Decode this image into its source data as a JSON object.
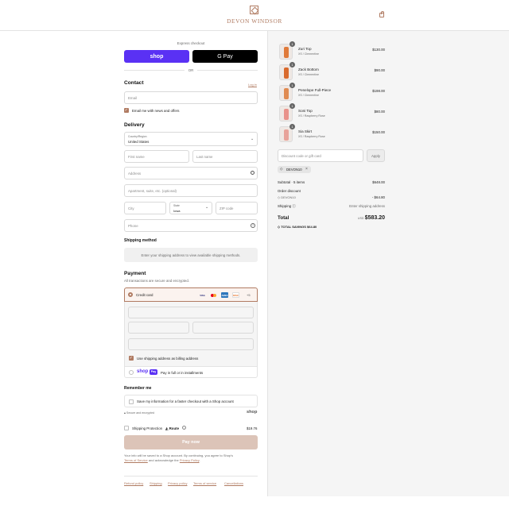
{
  "header": {
    "brand": "DEVON WINDSOR"
  },
  "express": {
    "label": "Express checkout",
    "shop_pay": "shop",
    "gpay": "G Pay",
    "or": "OR"
  },
  "contact": {
    "title": "Contact",
    "login": "Log in",
    "email_placeholder": "Email",
    "news_label": "Email me with news and offers"
  },
  "delivery": {
    "title": "Delivery",
    "country_label": "Country/Region",
    "country_value": "United States",
    "first_name": "First name",
    "last_name": "Last name",
    "address": "Address",
    "apartment": "Apartment, suite, etc. (optional)",
    "city": "City",
    "state_label": "State",
    "state_value": "Iowa",
    "zip": "ZIP code",
    "phone": "Phone"
  },
  "shipping": {
    "title": "Shipping method",
    "notice": "Enter your shipping address to view available shipping methods."
  },
  "payment": {
    "title": "Payment",
    "subtitle": "All transactions are secure and encrypted.",
    "credit_card": "Credit card",
    "more_cards": "+5",
    "billing_label": "Use shipping address as billing address",
    "shop_pay_label": "Pay in full or in installments",
    "shop_pay_logo": "shop",
    "shop_pay_badge": "Pay",
    "cards": [
      "VISA",
      "MC",
      "AMEX",
      "DISC"
    ]
  },
  "remember": {
    "title": "Remember me",
    "save_label": "Save my information for a faster checkout with a Shop account",
    "secure": "Secure and encrypted",
    "shop_logo": "shop"
  },
  "protection": {
    "label": "Shipping Protection",
    "route": "Route",
    "price": "$19.76"
  },
  "pay_now": "Pay now",
  "terms": {
    "line1": "Your info will be saved to a Shop account. By continuing, you agree to Shop's",
    "tos": "Terms of Service",
    "and": "and acknowledge the",
    "privacy": "Privacy Policy",
    "period": "."
  },
  "footer_links": [
    "Refund policy",
    "Shipping",
    "Privacy policy",
    "Terms of service",
    "Cancellations"
  ],
  "cart": {
    "items": [
      {
        "qty": "1",
        "name": "Zuri Top",
        "variant": "XS / Clementine",
        "price": "$130.00",
        "color": "#e07a3a"
      },
      {
        "qty": "1",
        "name": "Zack Bottom",
        "variant": "XS / Clementine",
        "price": "$90.00",
        "color": "#d9692c"
      },
      {
        "qty": "1",
        "name": "Penelope Full-Piece",
        "variant": "XS / Clementine",
        "price": "$198.00",
        "color": "#e08a50"
      },
      {
        "qty": "1",
        "name": "Soni Top",
        "variant": "XS / Raspberry Rose",
        "price": "$80.00",
        "color": "#e9928a"
      },
      {
        "qty": "1",
        "name": "Sia Skirt",
        "variant": "XS / Raspberry Rose",
        "price": "$150.00",
        "color": "#e8a39a"
      }
    ],
    "discount_placeholder": "Discount code or gift card",
    "apply": "Apply",
    "code_tag": "DEVON10",
    "subtotal_label": "Subtotal · 5 items",
    "subtotal_value": "$648.00",
    "order_discount_label": "Order discount",
    "code_label": "DEVON10",
    "discount_value": "- $64.80",
    "shipping_label": "Shipping",
    "shipping_value": "Enter shipping address",
    "total_label": "Total",
    "currency": "USD",
    "total_value": "$583.20",
    "savings_label": "TOTAL SAVINGS",
    "savings_value": "$64.80"
  },
  "colors": {
    "accent": "#b07b62",
    "shop_purple": "#5a31f4"
  }
}
